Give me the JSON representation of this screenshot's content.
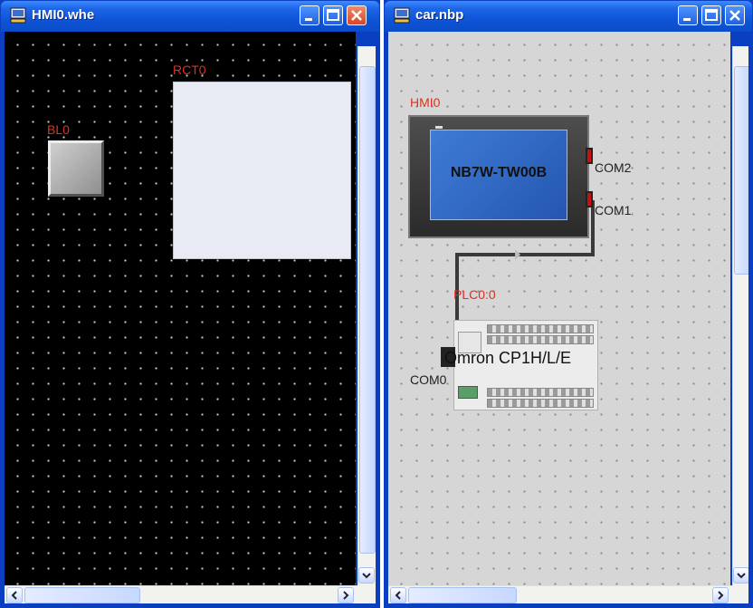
{
  "left_window": {
    "title": "HMI0.whe",
    "objects": [
      {
        "label": "BL0"
      },
      {
        "label": "RCT0"
      }
    ]
  },
  "right_window": {
    "title": "car.nbp",
    "hmi": {
      "label": "HMI0",
      "model": "NB7W-TW00B",
      "ports": [
        "COM2",
        "COM1"
      ]
    },
    "plc": {
      "label": "PLC0:0",
      "model": "Omron CP1H/L/E",
      "port": "COM0"
    }
  },
  "colors": {
    "titlebar": "#0f55d8",
    "label_red": "#e03020",
    "left_canvas_bg": "#000000",
    "right_canvas_bg": "#d6d6d6"
  },
  "icons": {
    "app_icon": "monitor-icon",
    "minimize": "minimize-icon",
    "maximize": "maximize-icon",
    "close": "close-icon"
  }
}
